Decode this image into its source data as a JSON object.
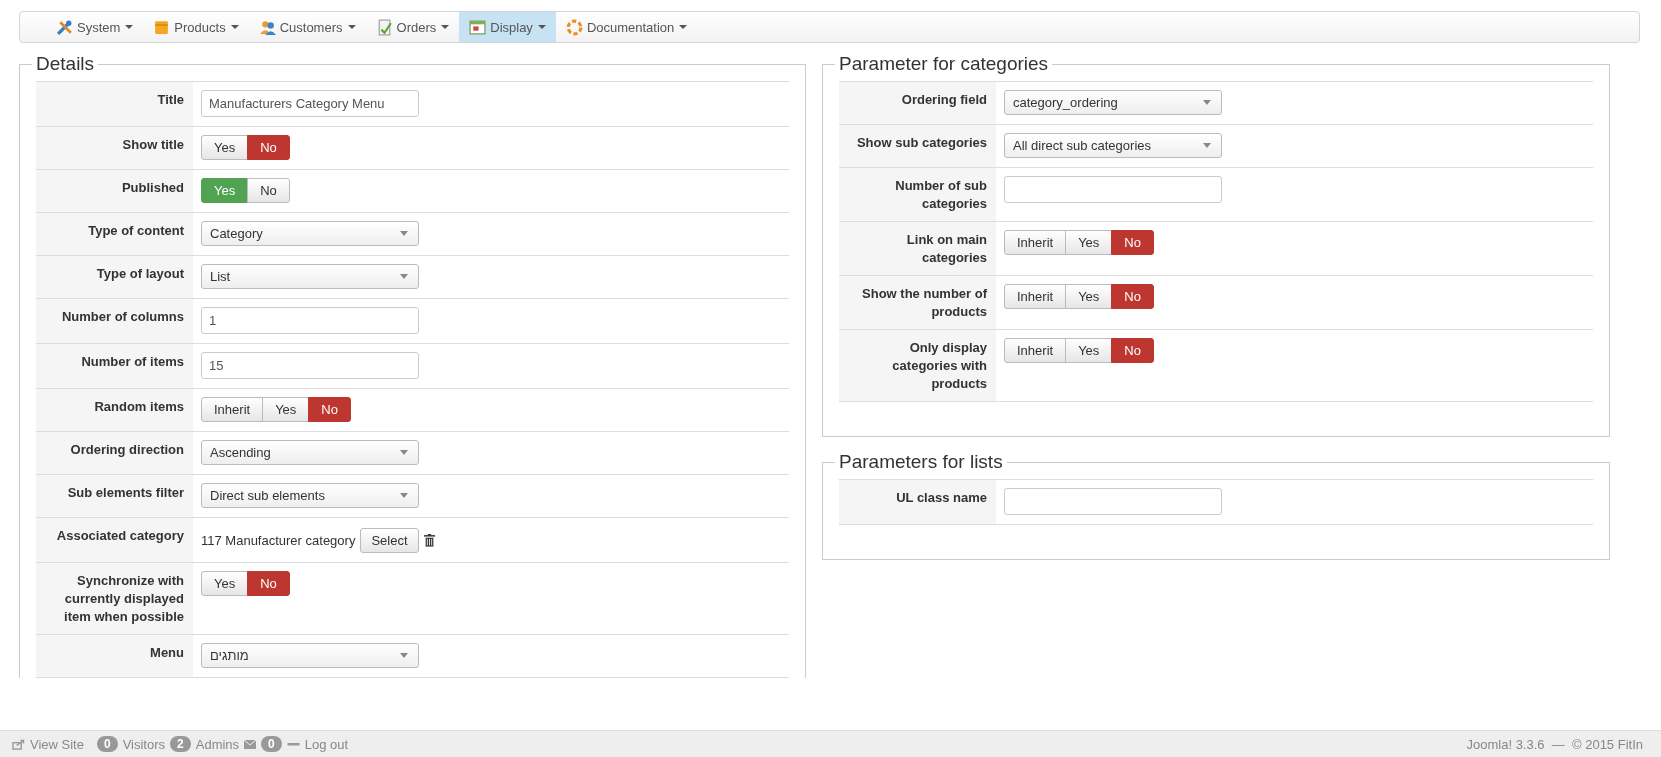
{
  "menu": [
    {
      "label": "System",
      "selected": false
    },
    {
      "label": "Products",
      "selected": false
    },
    {
      "label": "Customers",
      "selected": false
    },
    {
      "label": "Orders",
      "selected": false
    },
    {
      "label": "Display",
      "selected": true
    },
    {
      "label": "Documentation",
      "selected": false
    }
  ],
  "details": {
    "legend": "Details",
    "rows": [
      {
        "kind": "text",
        "label": "Title",
        "value": "Manufacturers Category Menu"
      },
      {
        "kind": "toggle",
        "label": "Show title",
        "options": [
          {
            "label": "Yes",
            "selected": false
          },
          {
            "label": "No",
            "selected": true,
            "color": "#bd362f"
          }
        ]
      },
      {
        "kind": "toggle",
        "label": "Published",
        "options": [
          {
            "label": "Yes",
            "selected": true,
            "color": "#51a351"
          },
          {
            "label": "No",
            "selected": false
          }
        ]
      },
      {
        "kind": "select",
        "label": "Type of content",
        "value": "Category"
      },
      {
        "kind": "select",
        "label": "Type of layout",
        "value": "List"
      },
      {
        "kind": "text",
        "label": "Number of columns",
        "value": "1"
      },
      {
        "kind": "text",
        "label": "Number of items",
        "value": "15"
      },
      {
        "kind": "toggle",
        "label": "Random items",
        "options": [
          {
            "label": "Inherit",
            "selected": false
          },
          {
            "label": "Yes",
            "selected": false
          },
          {
            "label": "No",
            "selected": true,
            "color": "#bd362f"
          }
        ]
      },
      {
        "kind": "select",
        "label": "Ordering direction",
        "value": "Ascending"
      },
      {
        "kind": "select",
        "label": "Sub elements filter",
        "value": "Direct sub elements"
      },
      {
        "kind": "category",
        "label": "Associated category",
        "value": "117 Manufacturer category",
        "button": "Select"
      },
      {
        "kind": "toggle",
        "label": "Synchronize with currently displayed item when possible",
        "options": [
          {
            "label": "Yes",
            "selected": false
          },
          {
            "label": "No",
            "selected": true,
            "color": "#bd362f"
          }
        ]
      },
      {
        "kind": "select",
        "label": "Menu",
        "value": "מותגים"
      }
    ]
  },
  "categories": {
    "legend": "Parameter for categories",
    "rows": [
      {
        "kind": "select",
        "label": "Ordering field",
        "value": "category_ordering"
      },
      {
        "kind": "select",
        "label": "Show sub categories",
        "value": "All direct sub categories"
      },
      {
        "kind": "text",
        "label": "Number of sub categories",
        "value": ""
      },
      {
        "kind": "toggle",
        "label": "Link on main categories",
        "options": [
          {
            "label": "Inherit",
            "selected": false
          },
          {
            "label": "Yes",
            "selected": false
          },
          {
            "label": "No",
            "selected": true,
            "color": "#bd362f"
          }
        ]
      },
      {
        "kind": "toggle",
        "label": "Show the number of products",
        "options": [
          {
            "label": "Inherit",
            "selected": false
          },
          {
            "label": "Yes",
            "selected": false
          },
          {
            "label": "No",
            "selected": true,
            "color": "#bd362f"
          }
        ]
      },
      {
        "kind": "toggle",
        "label": "Only display categories with products",
        "options": [
          {
            "label": "Inherit",
            "selected": false
          },
          {
            "label": "Yes",
            "selected": false
          },
          {
            "label": "No",
            "selected": true,
            "color": "#bd362f"
          }
        ]
      }
    ]
  },
  "lists": {
    "legend": "Parameters for lists",
    "rows": [
      {
        "kind": "text",
        "label": "UL class name",
        "value": ""
      }
    ]
  },
  "footer": {
    "view_site": "View Site",
    "visitors_count": "0",
    "visitors": "Visitors",
    "admins_count": "2",
    "admins": "Admins",
    "messages_count": "0",
    "logout": "Log out",
    "version": "Joomla! 3.3.6  —  © 2015 FitIn"
  }
}
